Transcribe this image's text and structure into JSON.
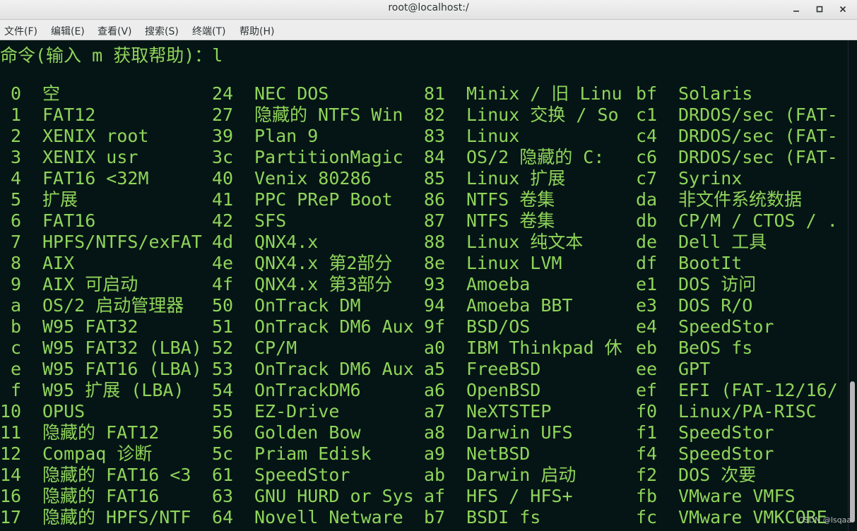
{
  "window": {
    "title": "root@localhost:/"
  },
  "menu": [
    "文件(F)",
    "编辑(E)",
    "查看(V)",
    "搜索(S)",
    "终端(T)",
    "帮助(H)"
  ],
  "prompt": "命令(输入 m 获取帮助)：l",
  "watermark": "CSDN @lsqaa",
  "columns": [
    [
      [
        "0",
        "空"
      ],
      [
        "1",
        "FAT12"
      ],
      [
        "2",
        "XENIX root"
      ],
      [
        "3",
        "XENIX usr"
      ],
      [
        "4",
        "FAT16 <32M"
      ],
      [
        "5",
        "扩展"
      ],
      [
        "6",
        "FAT16"
      ],
      [
        "7",
        "HPFS/NTFS/exFAT"
      ],
      [
        "8",
        "AIX"
      ],
      [
        "9",
        "AIX 可启动"
      ],
      [
        "a",
        "OS/2 启动管理器"
      ],
      [
        "b",
        "W95 FAT32"
      ],
      [
        "c",
        "W95 FAT32 (LBA)"
      ],
      [
        "e",
        "W95 FAT16 (LBA)"
      ],
      [
        "f",
        "W95 扩展 (LBA)"
      ],
      [
        "10",
        "OPUS"
      ],
      [
        "11",
        "隐藏的 FAT12"
      ],
      [
        "12",
        "Compaq 诊断"
      ],
      [
        "14",
        "隐藏的 FAT16 <3"
      ],
      [
        "16",
        "隐藏的 FAT16"
      ],
      [
        "17",
        "隐藏的 HPFS/NTF"
      ]
    ],
    [
      [
        "24",
        "NEC DOS"
      ],
      [
        "27",
        "隐藏的 NTFS Win"
      ],
      [
        "39",
        "Plan 9"
      ],
      [
        "3c",
        "PartitionMagic"
      ],
      [
        "40",
        "Venix 80286"
      ],
      [
        "41",
        "PPC PReP Boot"
      ],
      [
        "42",
        "SFS"
      ],
      [
        "4d",
        "QNX4.x"
      ],
      [
        "4e",
        "QNX4.x 第2部分"
      ],
      [
        "4f",
        "QNX4.x 第3部分"
      ],
      [
        "50",
        "OnTrack DM"
      ],
      [
        "51",
        "OnTrack DM6 Aux"
      ],
      [
        "52",
        "CP/M"
      ],
      [
        "53",
        "OnTrack DM6 Aux"
      ],
      [
        "54",
        "OnTrackDM6"
      ],
      [
        "55",
        "EZ-Drive"
      ],
      [
        "56",
        "Golden Bow"
      ],
      [
        "5c",
        "Priam Edisk"
      ],
      [
        "61",
        "SpeedStor"
      ],
      [
        "63",
        "GNU HURD or Sys"
      ],
      [
        "64",
        "Novell Netware"
      ]
    ],
    [
      [
        "81",
        "Minix / 旧 Linu"
      ],
      [
        "82",
        "Linux 交换 / So"
      ],
      [
        "83",
        "Linux"
      ],
      [
        "84",
        "OS/2 隐藏的 C:"
      ],
      [
        "85",
        "Linux 扩展"
      ],
      [
        "86",
        "NTFS 卷集"
      ],
      [
        "87",
        "NTFS 卷集"
      ],
      [
        "88",
        "Linux 纯文本"
      ],
      [
        "8e",
        "Linux LVM"
      ],
      [
        "93",
        "Amoeba"
      ],
      [
        "94",
        "Amoeba BBT"
      ],
      [
        "9f",
        "BSD/OS"
      ],
      [
        "a0",
        "IBM Thinkpad 休"
      ],
      [
        "a5",
        "FreeBSD"
      ],
      [
        "a6",
        "OpenBSD"
      ],
      [
        "a7",
        "NeXTSTEP"
      ],
      [
        "a8",
        "Darwin UFS"
      ],
      [
        "a9",
        "NetBSD"
      ],
      [
        "ab",
        "Darwin 启动"
      ],
      [
        "af",
        "HFS / HFS+"
      ],
      [
        "b7",
        "BSDI fs"
      ]
    ],
    [
      [
        "bf",
        "Solaris"
      ],
      [
        "c1",
        "DRDOS/sec (FAT-"
      ],
      [
        "c4",
        "DRDOS/sec (FAT-"
      ],
      [
        "c6",
        "DRDOS/sec (FAT-"
      ],
      [
        "c7",
        "Syrinx"
      ],
      [
        "da",
        "非文件系统数据"
      ],
      [
        "db",
        "CP/M / CTOS / ."
      ],
      [
        "de",
        "Dell 工具"
      ],
      [
        "df",
        "BootIt"
      ],
      [
        "e1",
        "DOS 访问"
      ],
      [
        "e3",
        "DOS R/O"
      ],
      [
        "e4",
        "SpeedStor"
      ],
      [
        "eb",
        "BeOS fs"
      ],
      [
        "ee",
        "GPT"
      ],
      [
        "ef",
        "EFI (FAT-12/16/"
      ],
      [
        "f0",
        "Linux/PA-RISC"
      ],
      [
        "f1",
        "SpeedStor"
      ],
      [
        "f4",
        "SpeedStor"
      ],
      [
        "f2",
        "DOS 次要"
      ],
      [
        "fb",
        "VMware VMFS"
      ],
      [
        "fc",
        "VMware VMKCORE"
      ]
    ]
  ]
}
